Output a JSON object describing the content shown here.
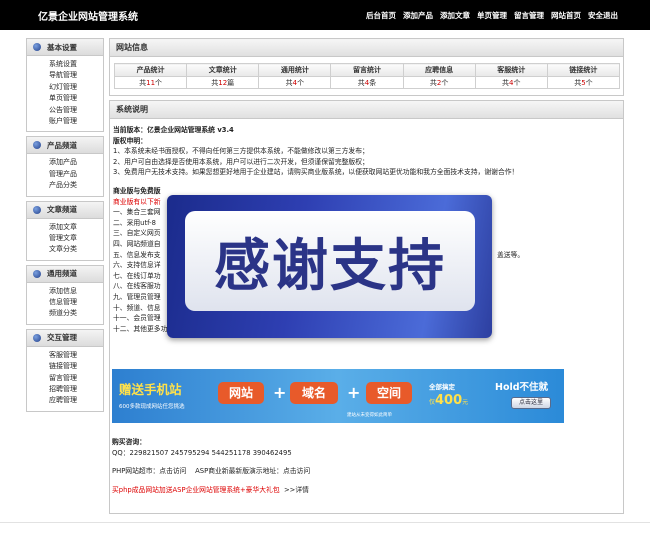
{
  "app_title": "亿景企业网站管理系统",
  "top_nav": [
    "后台首页",
    "添加产品",
    "添加文章",
    "单页管理",
    "留言管理",
    "网站首页",
    "安全退出"
  ],
  "sidebar": [
    {
      "title": "基本设置",
      "items": [
        "系统设置",
        "导航管理",
        "幻灯管理",
        "单页管理",
        "公告管理",
        "账户管理"
      ]
    },
    {
      "title": "产品频道",
      "items": [
        "添加产品",
        "管理产品",
        "产品分类"
      ]
    },
    {
      "title": "文章频道",
      "items": [
        "添加文章",
        "管理文章",
        "文章分类"
      ]
    },
    {
      "title": "通用频道",
      "items": [
        "添加信息",
        "信息管理",
        "频道分类"
      ]
    },
    {
      "title": "交互管理",
      "items": [
        "客服管理",
        "链接管理",
        "留言管理",
        "招聘管理",
        "应聘管理"
      ]
    }
  ],
  "site_info": {
    "title": "网站信息",
    "headers": [
      "产品统计",
      "文章统计",
      "通用统计",
      "留言统计",
      "应聘信息",
      "客服统计",
      "链接统计"
    ],
    "cells": [
      {
        "pre": "共",
        "num": "11",
        "unit": "个"
      },
      {
        "pre": "共",
        "num": "12",
        "unit": "篇"
      },
      {
        "pre": "共",
        "num": "4",
        "unit": "个"
      },
      {
        "pre": "共",
        "num": "4",
        "unit": "条"
      },
      {
        "pre": "共",
        "num": "2",
        "unit": "个"
      },
      {
        "pre": "共",
        "num": "4",
        "unit": "个"
      },
      {
        "pre": "共",
        "num": "5",
        "unit": "个"
      }
    ]
  },
  "system_info": {
    "title": "系统说明",
    "version_line": "当前版本：亿景企业网站管理系统 v3.4",
    "license_title": "版权申明：",
    "license_lines": [
      "1、本系统未经书面授权，不得向任何第三方提供本系统，不能做修改以第三方发布；",
      "2、用户可自由选择是否使用本系统，用户可以进行二次开发，但须谨保留完整版权；",
      "3、免费用户无技术支持。如果您想更好地用于企业建站，请购买商业版系统，以便获取网站更优功能和我方全面技术支持，谢谢合作！"
    ],
    "commercial_title": "商业版与免费版",
    "commercial_red": "商业版有以下新",
    "features": [
      "一、集合三套网",
      "二、采用utf-8",
      "三、自定义网页",
      "四、网站频道自",
      "五、信息发布支",
      "六、支持信息详",
      "七、在线订单功",
      "八、在线客服功",
      "九、管理员管理",
      "十、频道、信息",
      "十一、会员管理",
      "十二、其他更多功能，可咨询我们向您介绍。(http://www.yijingweb.com)。"
    ],
    "feature_tail": "盖送等。",
    "buy_title": "购买咨询：",
    "qq_line": "QQ：229821507  245795294  544251178  390462495",
    "php_line_a": "PHP网站超市：点击访问",
    "php_line_b": "ASP商业新最新版演示地址：点击访问",
    "promo_red": "买php成品网站加送ASP企业网站管理系统+豪华大礼包",
    "promo_more": ">>详情"
  },
  "popup": {
    "text": "感谢支持"
  },
  "banner": {
    "title": "赠送手机站",
    "subtitle": "600多款现成网站任您挑选",
    "pill1": "网站",
    "pill2": "域名",
    "pill3": "空间",
    "note": "建站从未变得如此简单",
    "price_label": "全部搞定",
    "price_prefix": "仅",
    "price": "400",
    "price_unit": "元",
    "hold": "Hold不住就",
    "button": "点击这里"
  }
}
